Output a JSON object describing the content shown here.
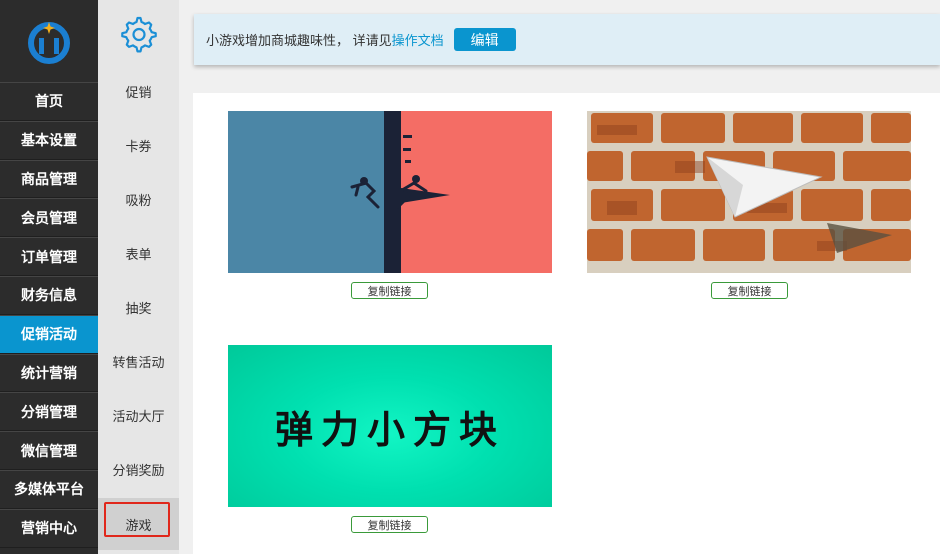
{
  "nav": {
    "items": [
      {
        "label": "首页"
      },
      {
        "label": "基本设置"
      },
      {
        "label": "商品管理"
      },
      {
        "label": "会员管理"
      },
      {
        "label": "订单管理"
      },
      {
        "label": "财务信息"
      },
      {
        "label": "促销活动",
        "active": true
      },
      {
        "label": "统计营销"
      },
      {
        "label": "分销管理"
      },
      {
        "label": "微信管理"
      },
      {
        "label": "多媒体平台"
      },
      {
        "label": "营销中心"
      }
    ]
  },
  "subnav": {
    "items": [
      {
        "label": "促销"
      },
      {
        "label": "卡券"
      },
      {
        "label": "吸粉"
      },
      {
        "label": "表单"
      },
      {
        "label": "抽奖"
      },
      {
        "label": "转售活动"
      },
      {
        "label": "活动大厅"
      },
      {
        "label": "分销奖励"
      },
      {
        "label": "游戏",
        "active": true
      }
    ]
  },
  "notice": {
    "text": "小游戏增加商城趣味性， 详请见",
    "link": "操作文档",
    "button": "编辑"
  },
  "games": [
    {
      "copy_label": "复制链接"
    },
    {
      "copy_label": "复制链接"
    },
    {
      "title": "弹力小方块",
      "copy_label": "复制链接"
    }
  ],
  "colors": {
    "accent": "#0a95cf",
    "sidebar": "#2c2c2c",
    "highlight_border": "#e0271b",
    "copy_border": "#3a9a3a"
  }
}
